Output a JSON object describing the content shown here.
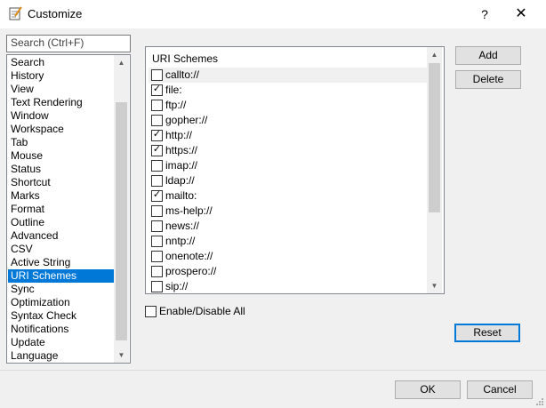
{
  "window": {
    "title": "Customize",
    "help_label": "?",
    "close_label": "✕",
    "icon": "notepad-icon"
  },
  "search": {
    "placeholder": "Search (Ctrl+F)",
    "value": ""
  },
  "categories": [
    {
      "label": "Search",
      "selected": false
    },
    {
      "label": "History",
      "selected": false
    },
    {
      "label": "View",
      "selected": false
    },
    {
      "label": "Text Rendering",
      "selected": false
    },
    {
      "label": "Window",
      "selected": false
    },
    {
      "label": "Workspace",
      "selected": false
    },
    {
      "label": "Tab",
      "selected": false
    },
    {
      "label": "Mouse",
      "selected": false
    },
    {
      "label": "Status",
      "selected": false
    },
    {
      "label": "Shortcut",
      "selected": false
    },
    {
      "label": "Marks",
      "selected": false
    },
    {
      "label": "Format",
      "selected": false
    },
    {
      "label": "Outline",
      "selected": false
    },
    {
      "label": "Advanced",
      "selected": false
    },
    {
      "label": "CSV",
      "selected": false
    },
    {
      "label": "Active String",
      "selected": false
    },
    {
      "label": "URI Schemes",
      "selected": true
    },
    {
      "label": "Sync",
      "selected": false
    },
    {
      "label": "Optimization",
      "selected": false
    },
    {
      "label": "Syntax Check",
      "selected": false
    },
    {
      "label": "Notifications",
      "selected": false
    },
    {
      "label": "Update",
      "selected": false
    },
    {
      "label": "Language",
      "selected": false
    }
  ],
  "uri_panel": {
    "title": "URI Schemes",
    "items": [
      {
        "label": "callto://",
        "checked": false
      },
      {
        "label": "file:",
        "checked": true
      },
      {
        "label": "ftp://",
        "checked": false
      },
      {
        "label": "gopher://",
        "checked": false
      },
      {
        "label": "http://",
        "checked": true
      },
      {
        "label": "https://",
        "checked": true
      },
      {
        "label": "imap://",
        "checked": false
      },
      {
        "label": "ldap://",
        "checked": false
      },
      {
        "label": "mailto:",
        "checked": true
      },
      {
        "label": "ms-help://",
        "checked": false
      },
      {
        "label": "news://",
        "checked": false
      },
      {
        "label": "nntp://",
        "checked": false
      },
      {
        "label": "onenote://",
        "checked": false
      },
      {
        "label": "prospero://",
        "checked": false
      },
      {
        "label": "sip://",
        "checked": false
      }
    ]
  },
  "buttons": {
    "add": "Add",
    "delete": "Delete",
    "reset": "Reset",
    "ok": "OK",
    "cancel": "Cancel"
  },
  "enable_all": {
    "label": "Enable/Disable All",
    "checked": false
  },
  "colors": {
    "selection": "#0078d7",
    "background": "#f0f0f0"
  }
}
